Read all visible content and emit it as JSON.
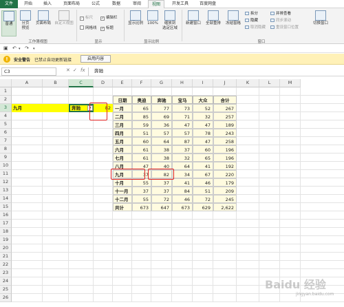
{
  "tabs": [
    "文件",
    "开始",
    "插入",
    "页面布局",
    "公式",
    "数据",
    "审阅",
    "视图",
    "开发工具",
    "百度网盘"
  ],
  "active_tab": "视图",
  "ribbon": {
    "workbook_views": {
      "normal": "普通",
      "page_break": "分页\n预览",
      "page_layout": "页面布局",
      "custom_views": "自定义视图",
      "label": "工作簿视图"
    },
    "show": {
      "ruler": "标尺",
      "formula_bar": "编辑栏",
      "gridlines": "网格线",
      "headings": "标题",
      "label": "显示"
    },
    "zoom": {
      "zoom": "显示比例",
      "zoom100": "100%",
      "zoom_selection": "缩放到\n选定区域",
      "label": "显示比例"
    },
    "window": {
      "new_window": "新建窗口",
      "arrange_all": "全部重排",
      "freeze_panes": "冻结窗格",
      "split": "拆分",
      "hide": "隐藏",
      "unhide": "取消隐藏",
      "side_by_side": "并排查看",
      "sync_scroll": "同步滚动",
      "reset_position": "重设窗口位置",
      "switch_windows": "切换窗口",
      "label": "窗口"
    }
  },
  "security": {
    "title": "安全警告",
    "message": "已禁止自动更新链接",
    "button": "启用内容"
  },
  "name_box": "C3",
  "formula_value": "奔驰",
  "columns": [
    "A",
    "B",
    "C",
    "D",
    "E",
    "F",
    "G",
    "H",
    "I",
    "J",
    "K",
    "L",
    "M"
  ],
  "rows": [
    "1",
    "2",
    "3",
    "4",
    "5",
    "6",
    "7",
    "8",
    "9",
    "10",
    "11",
    "12",
    "13",
    "14",
    "15",
    "16",
    "17",
    "18",
    "19",
    "20",
    "21",
    "22",
    "23",
    "24",
    "25",
    "26"
  ],
  "lookup": {
    "month": "九月",
    "brand": "奔驰",
    "result": "82"
  },
  "table": {
    "headers": [
      "日期",
      "奥迪",
      "奔驰",
      "宝马",
      "大众",
      "合计"
    ],
    "rows": [
      [
        "一月",
        "65",
        "77",
        "73",
        "52",
        "267"
      ],
      [
        "二月",
        "85",
        "69",
        "71",
        "32",
        "257"
      ],
      [
        "三月",
        "59",
        "36",
        "47",
        "47",
        "189"
      ],
      [
        "四月",
        "51",
        "57",
        "57",
        "78",
        "243"
      ],
      [
        "五月",
        "60",
        "64",
        "87",
        "47",
        "258"
      ],
      [
        "六月",
        "61",
        "38",
        "37",
        "60",
        "196"
      ],
      [
        "七月",
        "61",
        "38",
        "32",
        "65",
        "196"
      ],
      [
        "八月",
        "47",
        "40",
        "64",
        "41",
        "192"
      ],
      [
        "九月",
        "37",
        "82",
        "34",
        "67",
        "220"
      ],
      [
        "十月",
        "55",
        "37",
        "41",
        "46",
        "179"
      ],
      [
        "十一月",
        "37",
        "37",
        "84",
        "51",
        "209"
      ],
      [
        "十二月",
        "55",
        "72",
        "46",
        "72",
        "245"
      ],
      [
        "共计",
        "673",
        "647",
        "673",
        "629",
        "2,622"
      ]
    ]
  },
  "watermark": "Baidu 经验",
  "watermark_sub": "jingyan.baidu.com",
  "colors": {
    "excel_green": "#217346",
    "lookup_fill": "#ffff00",
    "table_fill": "#fffbe0",
    "highlight": "#e02020"
  }
}
